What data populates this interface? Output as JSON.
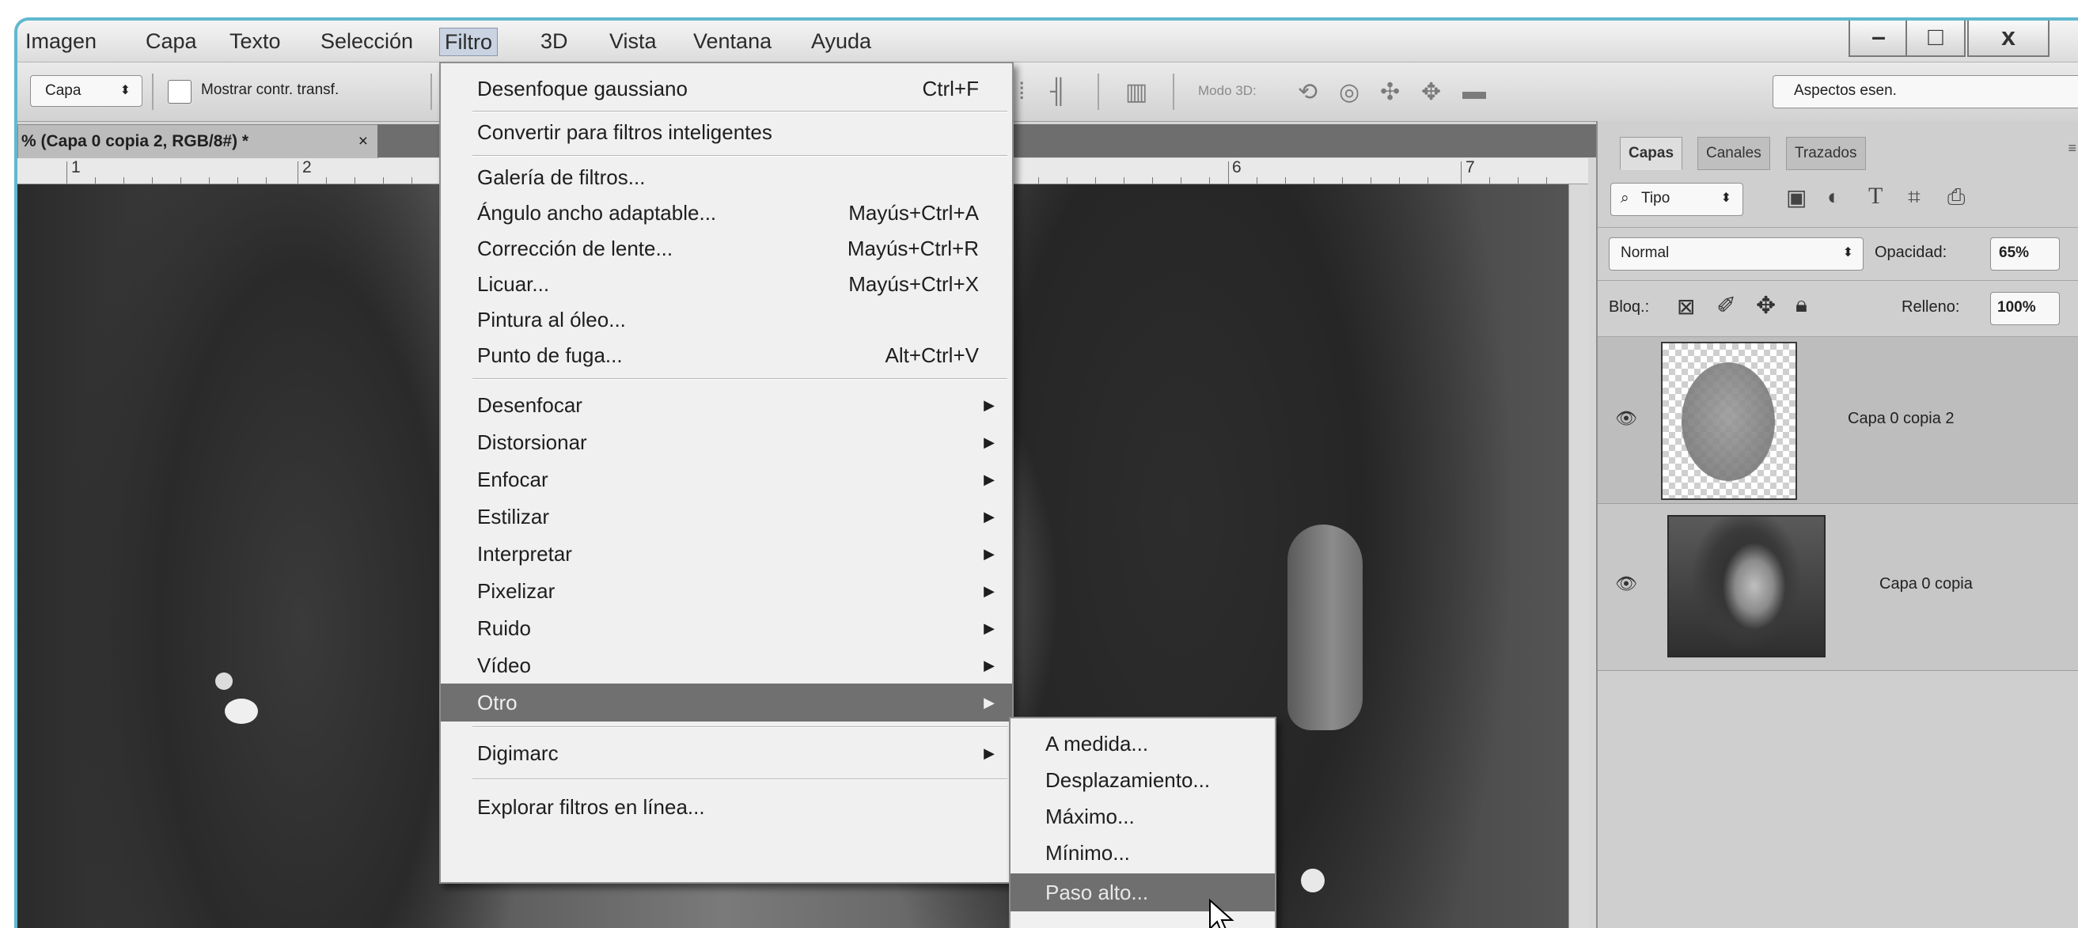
{
  "menubar": {
    "items": [
      "Imagen",
      "Capa",
      "Texto",
      "Selección",
      "Filtro",
      "3D",
      "Vista",
      "Ventana",
      "Ayuda"
    ],
    "active": "Filtro",
    "window_controls": [
      "–",
      "□",
      "x"
    ]
  },
  "options_bar": {
    "select_value": "Capa",
    "checkbox_label": "Mostrar contr. transf.",
    "mode_3d_label": "Modo 3D:",
    "workspace_value": "Aspectos esen."
  },
  "document_tab": {
    "title": "% (Capa 0 copia 2, RGB/8#) *",
    "close": "×"
  },
  "ruler": {
    "numbers": [
      "1",
      "2",
      "6",
      "7"
    ]
  },
  "filter_menu": {
    "items": [
      {
        "label": "Desenfoque gaussiano",
        "shortcut": "Ctrl+F"
      },
      {
        "label": "Convertir para filtros inteligentes",
        "shortcut": ""
      },
      {
        "label": "Galería de filtros...",
        "shortcut": ""
      },
      {
        "label": "Ángulo ancho adaptable...",
        "shortcut": "Mayús+Ctrl+A"
      },
      {
        "label": "Corrección de lente...",
        "shortcut": "Mayús+Ctrl+R"
      },
      {
        "label": "Licuar...",
        "shortcut": "Mayús+Ctrl+X"
      },
      {
        "label": "Pintura al óleo...",
        "shortcut": ""
      },
      {
        "label": "Punto de fuga...",
        "shortcut": "Alt+Ctrl+V"
      },
      {
        "label": "Desenfocar",
        "shortcut": ""
      },
      {
        "label": "Distorsionar",
        "shortcut": ""
      },
      {
        "label": "Enfocar",
        "shortcut": ""
      },
      {
        "label": "Estilizar",
        "shortcut": ""
      },
      {
        "label": "Interpretar",
        "shortcut": ""
      },
      {
        "label": "Pixelizar",
        "shortcut": ""
      },
      {
        "label": "Ruido",
        "shortcut": ""
      },
      {
        "label": "Vídeo",
        "shortcut": ""
      },
      {
        "label": "Otro",
        "shortcut": ""
      },
      {
        "label": "Digimarc",
        "shortcut": ""
      },
      {
        "label": "Explorar filtros en línea...",
        "shortcut": ""
      }
    ],
    "highlighted": "Otro"
  },
  "submenu_otro": {
    "items": [
      "A medida...",
      "Desplazamiento...",
      "Máximo...",
      "Mínimo...",
      "Paso alto..."
    ],
    "highlighted": "Paso alto..."
  },
  "layers_panel": {
    "tabs": [
      "Capas",
      "Canales",
      "Trazados"
    ],
    "active_tab": "Capas",
    "filter_kind": "Tipo",
    "blend_mode": "Normal",
    "opacity_label": "Opacidad:",
    "opacity_value": "65%",
    "lock_label": "Bloq.:",
    "fill_label": "Relleno:",
    "fill_value": "100%",
    "layers": [
      {
        "name": "Capa 0 copia 2",
        "selected": true
      },
      {
        "name": "Capa 0 copia",
        "selected": false
      }
    ]
  },
  "colors": {
    "menu_highlight": "#707070",
    "active_menu": "#c9d3e1",
    "window_border": "#5fb8cf"
  }
}
